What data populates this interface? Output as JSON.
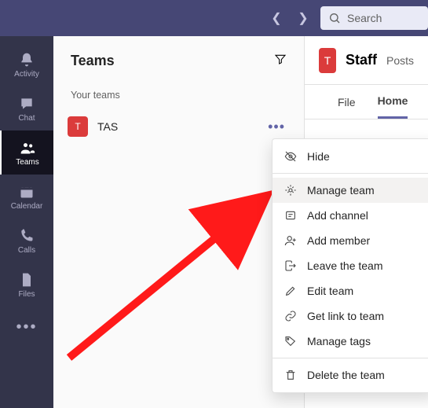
{
  "search": {
    "placeholder": "Search"
  },
  "rail": {
    "items": [
      {
        "label": "Activity"
      },
      {
        "label": "Chat"
      },
      {
        "label": "Teams"
      },
      {
        "label": "Calendar"
      },
      {
        "label": "Calls"
      },
      {
        "label": "Files"
      }
    ]
  },
  "teams": {
    "header": "Teams",
    "section_label": "Your teams",
    "list": [
      {
        "initial": "T",
        "name": "TAS"
      }
    ]
  },
  "content": {
    "team_initial": "T",
    "team_name": "Staff",
    "channel_label": "Posts",
    "tabs": [
      {
        "label": "File"
      },
      {
        "label": "Home",
        "active": true
      }
    ]
  },
  "context_menu": {
    "items": [
      {
        "label": "Hide"
      },
      {
        "label": "Manage team",
        "highlighted": true
      },
      {
        "label": "Add channel"
      },
      {
        "label": "Add member"
      },
      {
        "label": "Leave the team"
      },
      {
        "label": "Edit team"
      },
      {
        "label": "Get link to team"
      },
      {
        "label": "Manage tags"
      },
      {
        "label": "Delete the team"
      }
    ]
  },
  "colors": {
    "accent": "#6264a7",
    "rail_bg": "#33344a",
    "danger": "#db3b3b"
  }
}
